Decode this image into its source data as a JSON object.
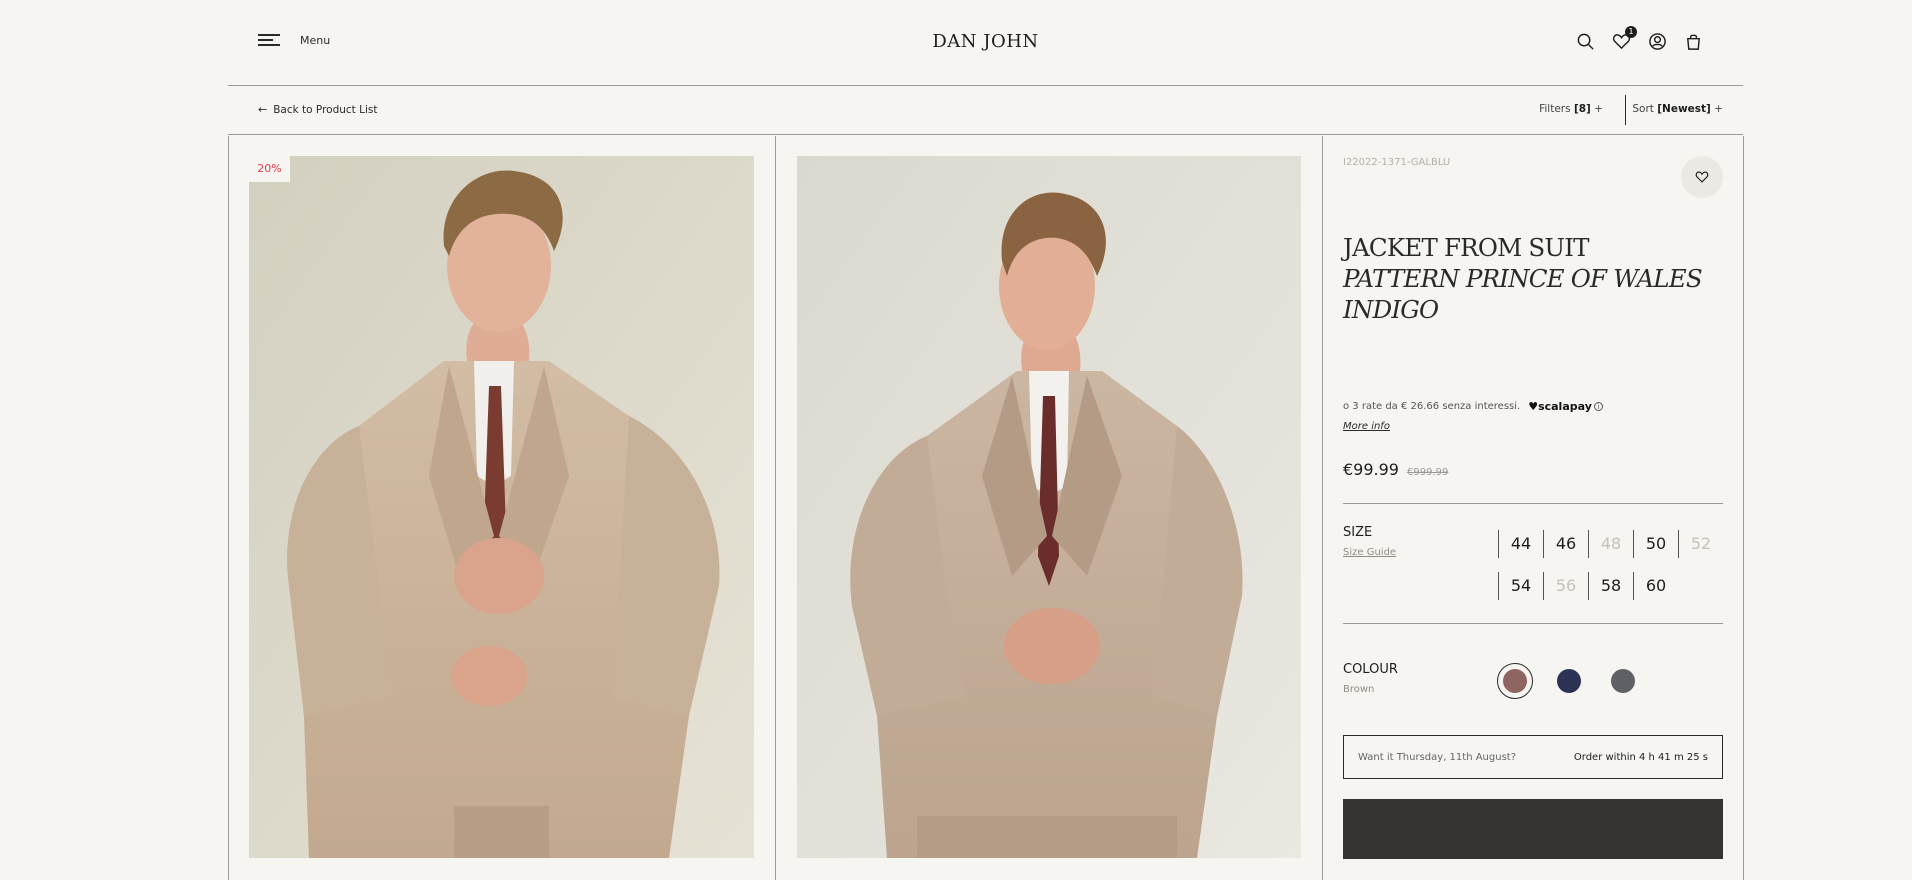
{
  "header": {
    "menu_label": "Menu",
    "brand": "DAN JOHN",
    "wishlist_count": "1",
    "icons": [
      "search-icon",
      "heart-icon",
      "user-icon",
      "bag-icon"
    ]
  },
  "subbar": {
    "back_label": "Back to Product List",
    "filters_label": "Filters",
    "filters_count": "[8]",
    "filters_suffix": "+",
    "sort_label": "Sort",
    "sort_value": "[Newest]",
    "sort_suffix": "+"
  },
  "gallery": {
    "discount_badge": "20%",
    "discount_color": "#e0414b"
  },
  "product": {
    "sku": "I22022-1371-GALBLU",
    "title_line1": "JACKET FROM SUIT",
    "title_line2": "PATTERN PRINCE OF WALES",
    "title_line3": "INDIGO",
    "installments_text": "o 3 rate da € 26.66 senza interessi.",
    "installments_brand": "♥scalapay",
    "installments_info": "i",
    "more_info": "More info",
    "price": "€99.99",
    "price_old": "€999.99",
    "size_label": "SIZE",
    "size_guide": "Size Guide",
    "sizes": [
      {
        "label": "44",
        "available": true
      },
      {
        "label": "46",
        "available": true
      },
      {
        "label": "48",
        "available": false
      },
      {
        "label": "50",
        "available": true
      },
      {
        "label": "52",
        "available": false
      },
      {
        "label": "54",
        "available": true
      },
      {
        "label": "56",
        "available": false
      },
      {
        "label": "58",
        "available": true
      },
      {
        "label": "60",
        "available": true
      }
    ],
    "colour_label": "COLOUR",
    "colour_selected": "Brown",
    "colours": [
      "#8f6561",
      "#2d3354",
      "#5f6166"
    ],
    "delivery_question": "Want it Thursday, 11th August?",
    "delivery_timer": "Order within 4 h 41 m 25 s",
    "add_button_color": "#353432"
  }
}
